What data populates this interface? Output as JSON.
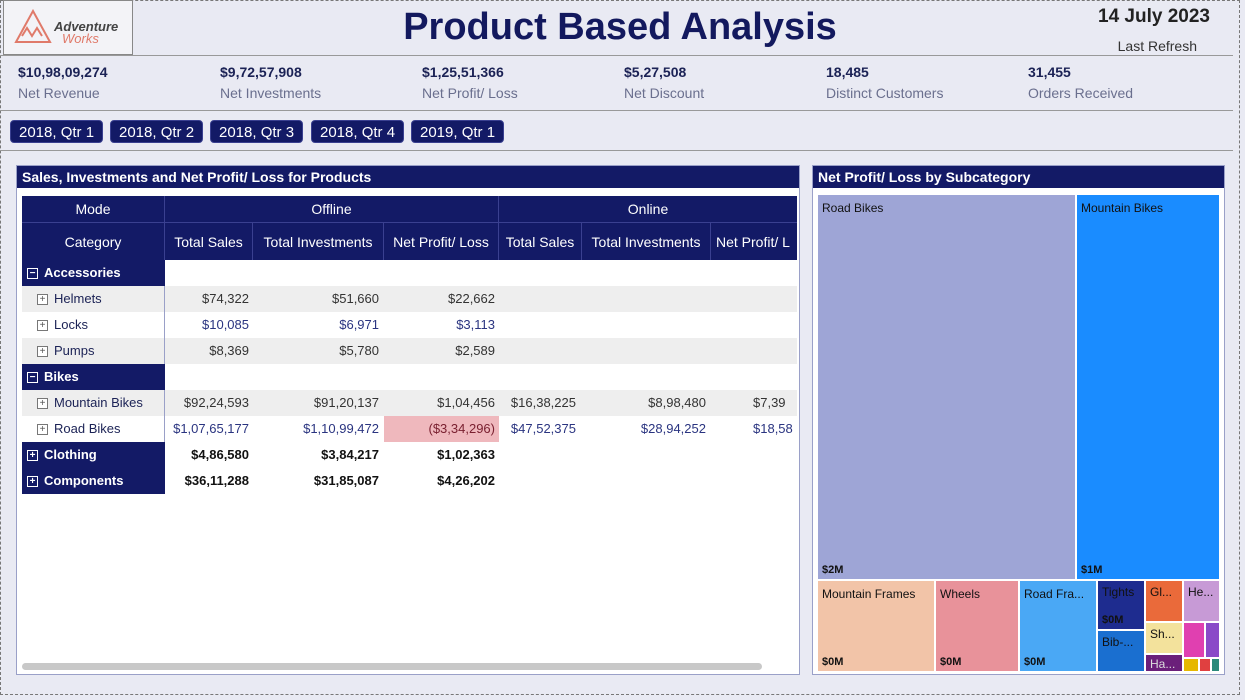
{
  "header": {
    "logo_line1": "Adventure",
    "logo_line2": "Works",
    "title": "Product Based Analysis",
    "date": "14 July 2023",
    "refresh_label": "Last Refresh"
  },
  "kpis": [
    {
      "value": "$10,98,09,274",
      "label": "Net Revenue"
    },
    {
      "value": "$9,72,57,908",
      "label": "Net Investments"
    },
    {
      "value": "$1,25,51,366",
      "label": "Net Profit/ Loss"
    },
    {
      "value": "$5,27,508",
      "label": "Net Discount"
    },
    {
      "value": "18,485",
      "label": "Distinct Customers"
    },
    {
      "value": "31,455",
      "label": "Orders Received"
    }
  ],
  "slicers": [
    "2018, Qtr 1",
    "2018, Qtr 2",
    "2018, Qtr 3",
    "2018, Qtr 4",
    "2019, Qtr 1"
  ],
  "matrix": {
    "title": "Sales, Investments and Net Profit/ Loss for Products",
    "mode_label": "Mode",
    "category_label": "Category",
    "group_offline": "Offline",
    "group_online": "Online",
    "col_sales": "Total Sales",
    "col_invest": "Total Investments",
    "col_profit": "Net Profit/ Loss",
    "col_profit_cut": "Net Profit/ L",
    "rows": {
      "accessories": {
        "label": "Accessories"
      },
      "helmets": {
        "label": "Helmets",
        "off_sales": "$74,322",
        "off_inv": "$51,660",
        "off_pl": "$22,662"
      },
      "locks": {
        "label": "Locks",
        "off_sales": "$10,085",
        "off_inv": "$6,971",
        "off_pl": "$3,113"
      },
      "pumps": {
        "label": "Pumps",
        "off_sales": "$8,369",
        "off_inv": "$5,780",
        "off_pl": "$2,589"
      },
      "bikes": {
        "label": "Bikes"
      },
      "mountain": {
        "label": "Mountain Bikes",
        "off_sales": "$92,24,593",
        "off_inv": "$91,20,137",
        "off_pl": "$1,04,456",
        "on_sales": "$16,38,225",
        "on_inv": "$8,98,480",
        "on_pl": "$7,39"
      },
      "road": {
        "label": "Road Bikes",
        "off_sales": "$1,07,65,177",
        "off_inv": "$1,10,99,472",
        "off_pl": "($3,34,296)",
        "on_sales": "$47,52,375",
        "on_inv": "$28,94,252",
        "on_pl": "$18,58"
      },
      "clothing": {
        "label": "Clothing",
        "off_sales": "$4,86,580",
        "off_inv": "$3,84,217",
        "off_pl": "$1,02,363"
      },
      "components": {
        "label": "Components",
        "off_sales": "$36,11,288",
        "off_inv": "$31,85,087",
        "off_pl": "$4,26,202"
      }
    }
  },
  "treemap": {
    "title": "Net Profit/ Loss by Subcategory",
    "tiles": [
      {
        "name": "Road Bikes",
        "value": "$2M",
        "color": "#9ea5d6"
      },
      {
        "name": "Mountain Bikes",
        "value": "$1M",
        "color": "#1a8cff"
      },
      {
        "name": "Mountain Frames",
        "value": "$0M",
        "color": "#f2c4a8"
      },
      {
        "name": "Wheels",
        "value": "$0M",
        "color": "#e8929a"
      },
      {
        "name": "Road Fra...",
        "value": "$0M",
        "color": "#4aa8f5"
      },
      {
        "name": "Tights",
        "value": "$0M",
        "color": "#1e2c8f"
      },
      {
        "name": "Bib-...",
        "value": "",
        "color": "#1a6fd0"
      },
      {
        "name": "Gl...",
        "value": "",
        "color": "#ea6a3a"
      },
      {
        "name": "He...",
        "value": "",
        "color": "#c79ad6"
      },
      {
        "name": "Sh...",
        "value": "",
        "color": "#f3e29c"
      },
      {
        "name": "Ha...",
        "value": "",
        "color": "#6b1f7a"
      }
    ]
  }
}
